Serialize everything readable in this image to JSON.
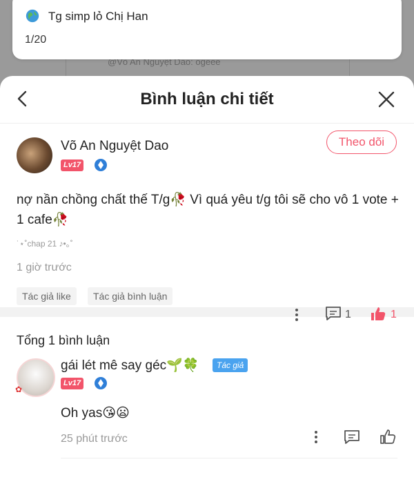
{
  "background": {
    "ghost_text": "@Võ An Nguyệt Dao: ogeee"
  },
  "notification": {
    "title": "Tg simp lỏ Chị Han",
    "counter": "1/20"
  },
  "sheet": {
    "title": "Bình luận chi tiết"
  },
  "comment": {
    "username": "Võ An Nguyệt Dao",
    "level": "Lv17",
    "follow_label": "Theo dõi",
    "text": "nợ nần chồng chất thế T/g🥀 Vì quá yêu t/g tôi sẽ cho vô 1 vote + 1 cafe🥀",
    "meta": "˙⋆˚chap 21 ♪•｡˚",
    "time": "1 giờ trước",
    "comment_count": "1",
    "like_count": "1",
    "tags": [
      "Tác giả like",
      "Tác giả bình luận"
    ]
  },
  "replies": {
    "total_label": "Tổng 1 bình luận",
    "items": [
      {
        "username": "gái lét mê say géc🌱🍀",
        "badge": "Tác giả",
        "level": "Lv17",
        "text": "Oh yas😘😦",
        "time": "25 phút trước"
      }
    ]
  },
  "colors": {
    "accent": "#f2546a",
    "author_badge": "#4aa3ef",
    "muted_text": "#999999"
  }
}
